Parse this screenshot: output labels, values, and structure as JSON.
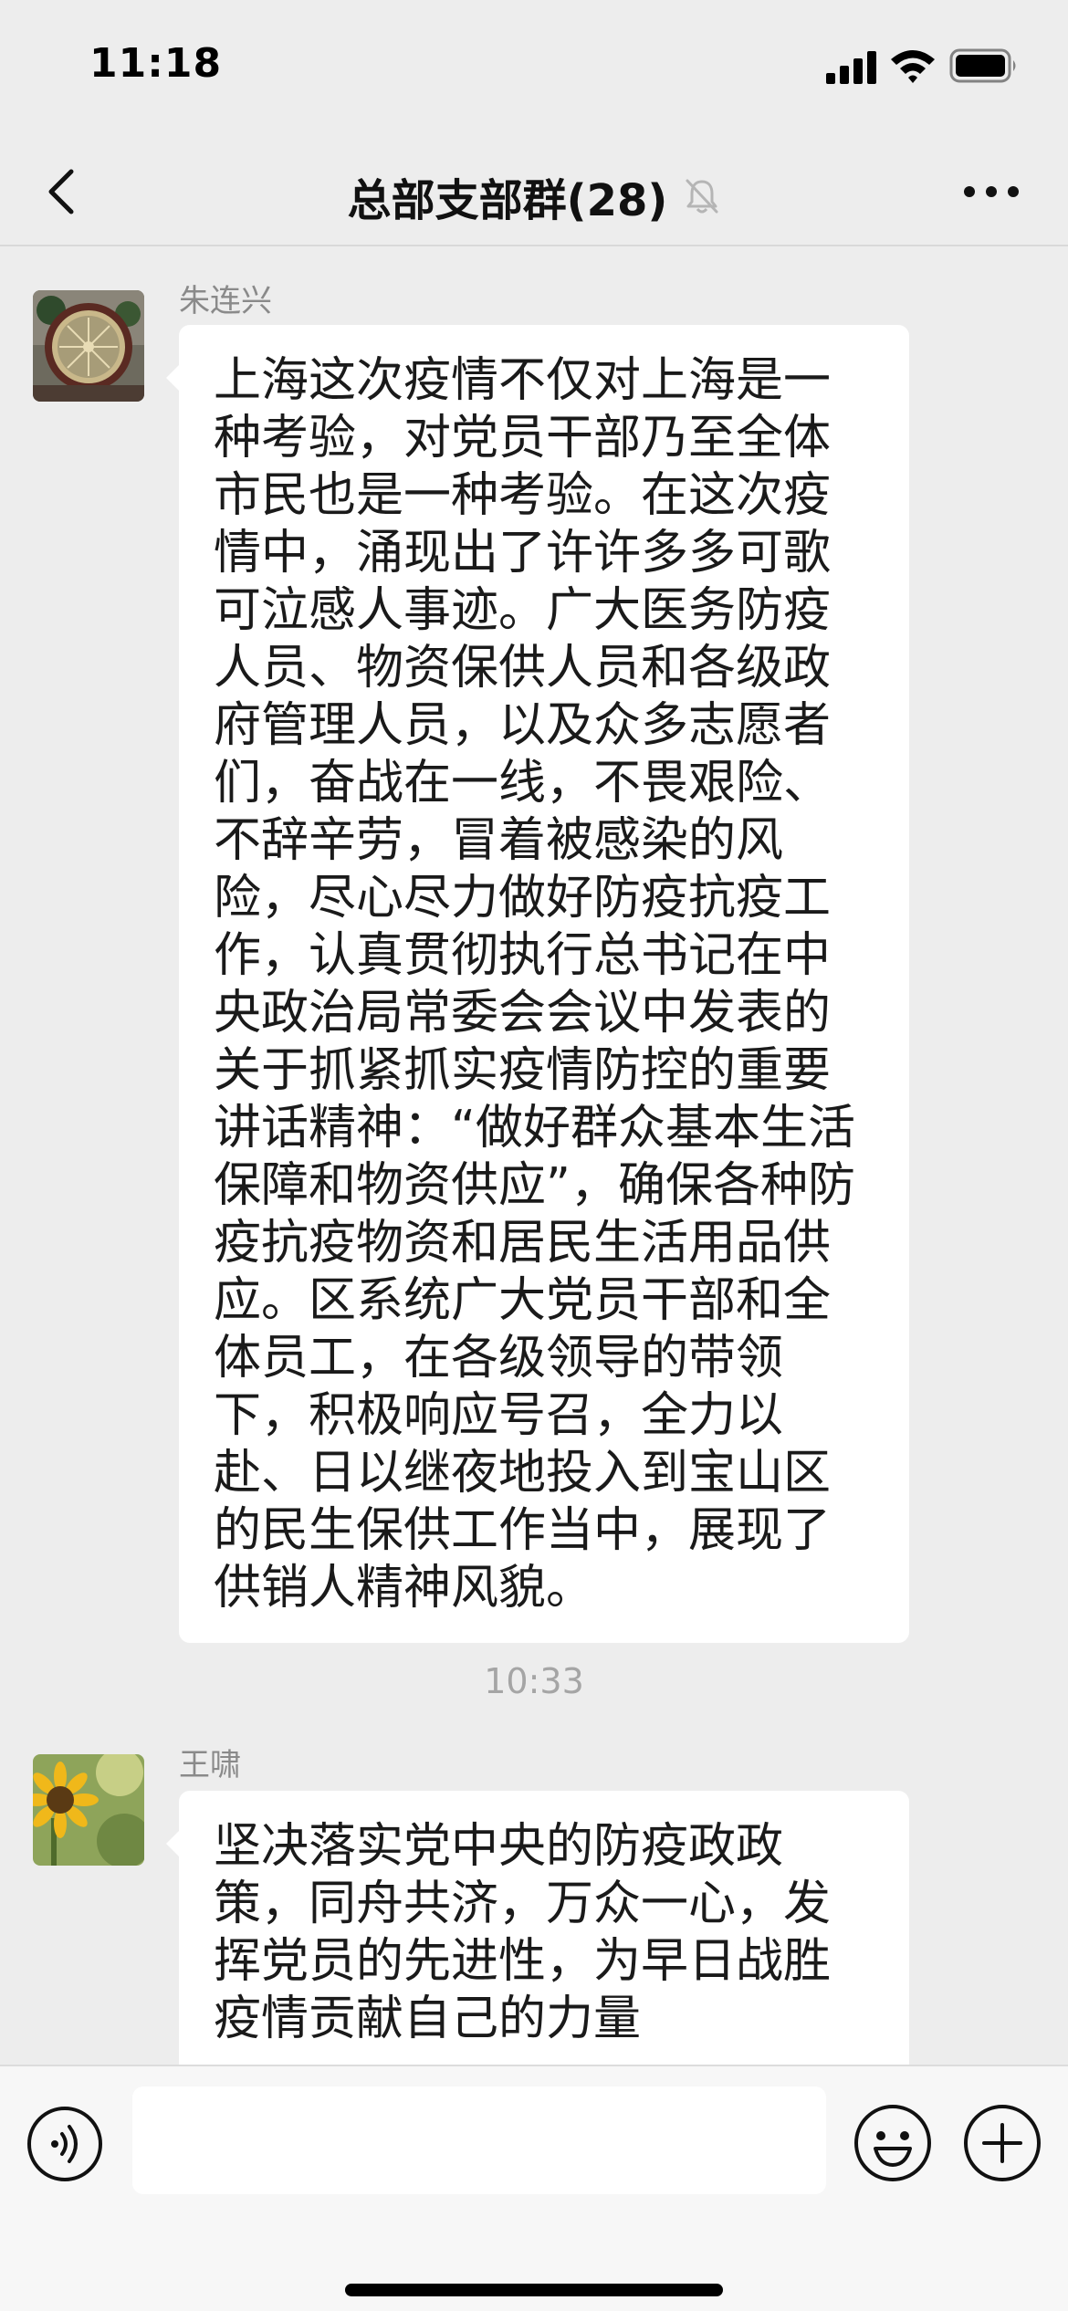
{
  "status_bar": {
    "time": "11:18"
  },
  "nav": {
    "title": "总部支部群(28)"
  },
  "messages": [
    {
      "sender": "朱连兴",
      "avatar": "lemon-slice-avatar",
      "text": "上海这次疫情不仅对上海是一种考验，对党员干部乃至全体市民也是一种考验。在这次疫情中，涌现出了许许多多可歌可泣感人事迹。广大医务防疫人员、物资保供人员和各级政府管理人员，以及众多志愿者们，奋战在一线，不畏艰险、不辞辛劳，冒着被感染的风险，尽心尽力做好防疫抗疫工作，认真贯彻执行总书记在中央政治局常委会会议中发表的关于抓紧抓实疫情防控的重要讲话精神：“做好群众基本生活保障和物资供应”，确保各种防疫抗疫物资和居民生活用品供应。区系统广大党员干部和全体员工，在各级领导的带领下，积极响应号召，全力以赴、日以继夜地投入到宝山区的民生保供工作当中，展现了供销人精神风貌。"
    },
    {
      "sender": "王啸",
      "avatar": "sunflower-avatar",
      "text": "坚决落实党中央的防疫政政策，同舟共济，万众一心，发挥党员的先进性，为早日战胜疫情贡献自己的力量"
    }
  ],
  "timestamp": "10:33",
  "input": {
    "placeholder": ""
  },
  "colors": {
    "background": "#ededed",
    "bubble": "#ffffff",
    "muted_text": "#8a8a8a"
  }
}
